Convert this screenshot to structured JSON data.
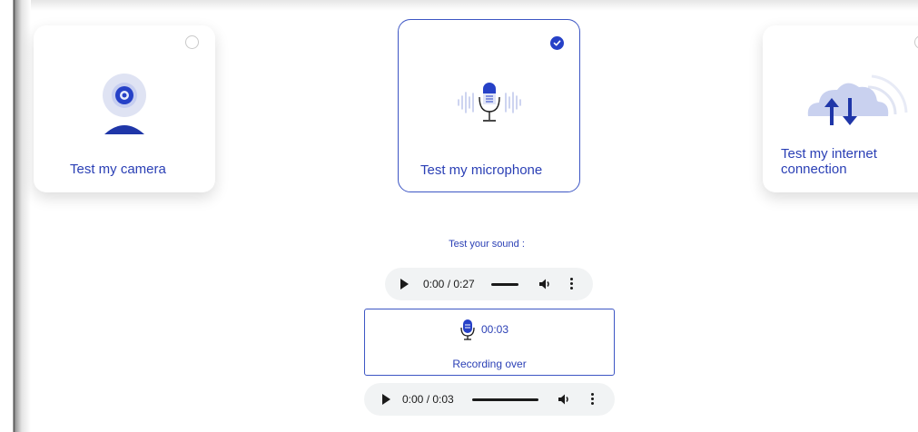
{
  "cards": {
    "camera": {
      "label": "Test my camera",
      "selected": false
    },
    "microphone": {
      "label": "Test my microphone",
      "selected": true
    },
    "internet": {
      "label_line1": "Test my internet",
      "label_line2": "connection",
      "selected": false
    }
  },
  "sound_test": {
    "title": "Test your sound :",
    "sample_player": {
      "time": "0:00 / 0:27"
    },
    "recorder": {
      "timer": "00:03",
      "status": "Recording over"
    },
    "recording_player": {
      "time": "0:00 / 0:03"
    }
  },
  "icons": {
    "camera": "webcam-icon",
    "microphone": "microphone-icon",
    "internet": "cloud-transfer-icon",
    "play": "play-icon",
    "volume": "volume-icon",
    "more": "more-vertical-icon",
    "check": "check-icon"
  },
  "colors": {
    "accent": "#2641c7",
    "text_accent": "#2a3fb5",
    "player_bg": "#f1f3f4"
  }
}
